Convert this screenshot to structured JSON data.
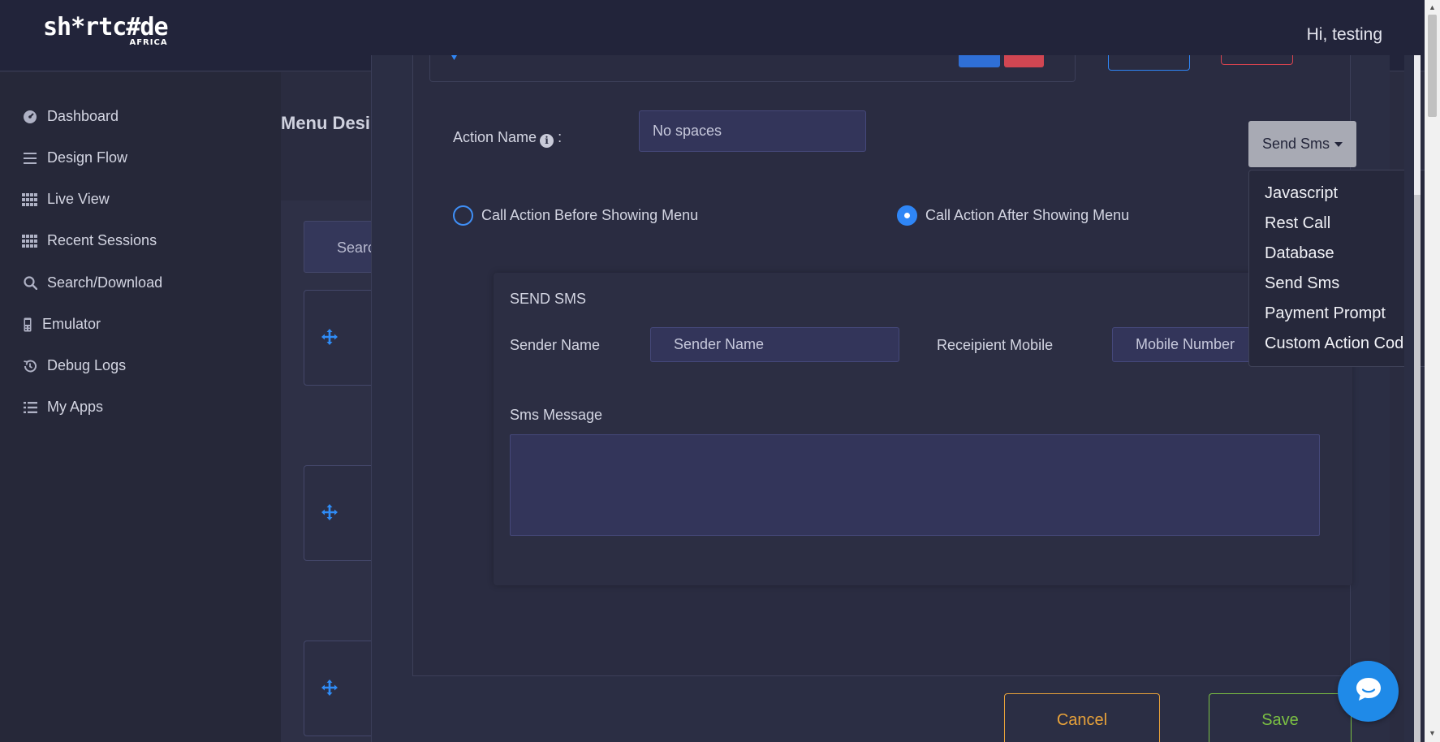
{
  "header": {
    "logo_main": "sh*rtc#de",
    "logo_sub": "AFRICA",
    "greeting": "Hi, testing"
  },
  "sidebar": {
    "items": [
      {
        "label": "Dashboard",
        "icon": "dashboard-gauge-icon"
      },
      {
        "label": "Design Flow",
        "icon": "menu-lines-icon"
      },
      {
        "label": "Live View",
        "icon": "grid-dots-icon"
      },
      {
        "label": "Recent Sessions",
        "icon": "grid-dots-icon"
      },
      {
        "label": "Search/Download",
        "icon": "search-icon"
      },
      {
        "label": "Emulator",
        "icon": "phone-icon"
      },
      {
        "label": "Debug Logs",
        "icon": "history-icon"
      },
      {
        "label": "My Apps",
        "icon": "list-icon"
      }
    ]
  },
  "background": {
    "title": "Menu Desi",
    "search_text": "Searc"
  },
  "modal": {
    "action_name_label": "Action Name",
    "action_name_colon": ":",
    "action_name_placeholder": "No spaces",
    "radio_before": "Call Action Before Showing Menu",
    "radio_after": "Call Action After Showing Menu",
    "selected_timing": "after",
    "sms": {
      "heading": "SEND SMS",
      "sender_label": "Sender Name",
      "sender_placeholder": "Sender Name",
      "recipient_label": "Receipient Mobile",
      "recipient_placeholder": "Mobile Number",
      "message_label": "Sms Message"
    },
    "action_type": {
      "selected": "Send Sms",
      "options": [
        "Javascript",
        "Rest Call",
        "Database",
        "Send Sms",
        "Payment Prompt",
        "Custom Action Code"
      ]
    },
    "cancel_label": "Cancel",
    "save_label": "Save"
  },
  "colors": {
    "accent_blue": "#2f86f6",
    "cancel": "#e8a23a",
    "save": "#7bc043",
    "danger": "#d9434f"
  }
}
